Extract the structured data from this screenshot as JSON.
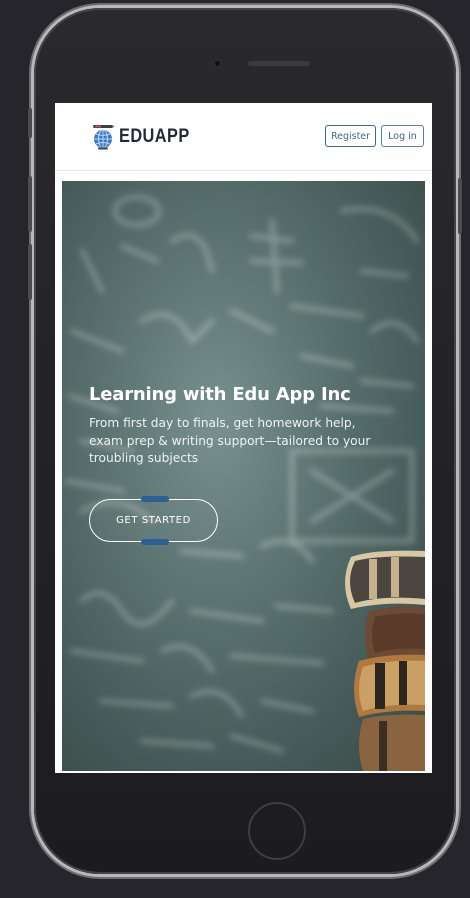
{
  "app": {
    "logo_text": "EDUAPP"
  },
  "nav": {
    "register_label": "Register",
    "login_label": "Log in"
  },
  "hero": {
    "title": "Learning with Edu App Inc",
    "subtitle": "From first day to finals, get homework help, exam prep & writing support—tailored to your troubling subjects",
    "cta_label": "GET STARTED"
  },
  "colors": {
    "page_background": "#25252b",
    "hero_chalkboard": "#5e7a77",
    "cta_marker": "#2b5f96",
    "nav_button_border": "#3f6d78"
  },
  "icons": {
    "logo": "globe-with-pencil-icon"
  }
}
